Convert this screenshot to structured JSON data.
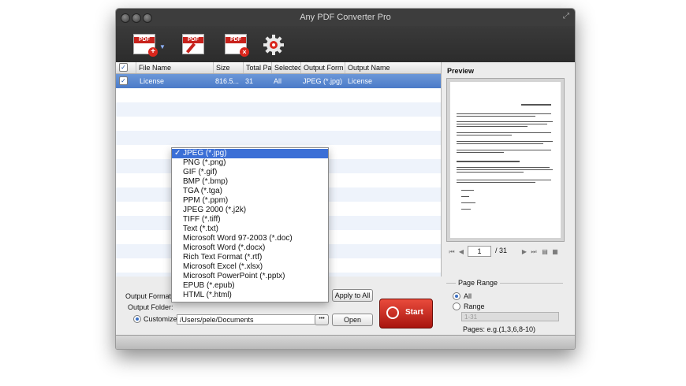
{
  "window": {
    "title": "Any PDF Converter Pro"
  },
  "toolbar": {
    "buttons": [
      {
        "icon": "add-pdf-icon",
        "label": "PDF"
      },
      {
        "icon": "edit-pdf-icon",
        "label": "PDF"
      },
      {
        "icon": "remove-pdf-icon",
        "label": "PDF"
      },
      {
        "icon": "settings-gear-icon"
      }
    ]
  },
  "table": {
    "columns": [
      "File Name",
      "Size",
      "Total Pa",
      "Selectec",
      "Output Form",
      "Output Name"
    ],
    "rows": [
      {
        "checked": true,
        "file_name": "License",
        "size": "816.5...",
        "total_pages": "31",
        "selected": "All",
        "output_format": "JPEG (*.jpg)",
        "output_name": "License"
      }
    ]
  },
  "format_dropdown": {
    "selected": "JPEG (*.jpg)",
    "options": [
      "JPEG (*.jpg)",
      "PNG (*.png)",
      "GIF (*.gif)",
      "BMP (*.bmp)",
      "TGA (*.tga)",
      "PPM (*.ppm)",
      "JPEG 2000 (*.j2k)",
      "TIFF (*.tiff)",
      "Text (*.txt)",
      "Microsoft Word 97-2003 (*.doc)",
      "Microsoft Word (*.docx)",
      "Rich Text Format (*.rtf)",
      "Microsoft Excel (*.xlsx)",
      "Microsoft PowerPoint (*.pptx)",
      "EPUB (*.epub)",
      "HTML (*.html)"
    ],
    "check_glyph": "✓"
  },
  "output": {
    "format_label": "Output Format:",
    "folder_label": "Output Folder:",
    "customize_label": "Customize:",
    "path": "/Users/pele/Documents",
    "browse_label": "•••",
    "open_label": "Open",
    "apply_all_label": "Apply to All",
    "start_label": "Start"
  },
  "preview": {
    "title": "Preview",
    "current_page": "1",
    "total_pages": "/ 31"
  },
  "page_range": {
    "title": "Page Range",
    "all_label": "All",
    "range_label": "Range",
    "range_placeholder": "1-31",
    "hint": "Pages: e.g.(1,3,6,8-10)",
    "selected": "All"
  }
}
